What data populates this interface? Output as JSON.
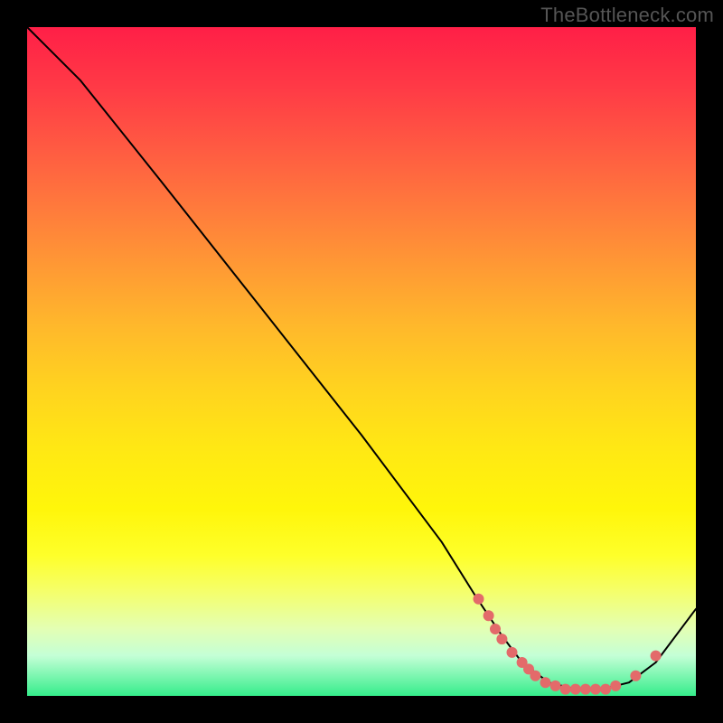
{
  "watermark": "TheBottleneck.com",
  "chart_data": {
    "type": "line",
    "title": "",
    "xlabel": "",
    "ylabel": "",
    "xlim": [
      0,
      100
    ],
    "ylim": [
      0,
      100
    ],
    "grid": false,
    "legend": false,
    "series": [
      {
        "name": "curve",
        "x": [
          0,
          3,
          8,
          20,
          35,
          50,
          62,
          67,
          71,
          74,
          78,
          82,
          86,
          90,
          94,
          100
        ],
        "y": [
          100,
          97,
          92,
          77,
          58,
          39,
          23,
          15,
          9,
          5,
          2,
          1,
          1,
          2,
          5,
          13
        ]
      }
    ],
    "markers": {
      "name": "dots",
      "color": "#e36a6a",
      "x": [
        67.5,
        69,
        70,
        71,
        72.5,
        74,
        75,
        76,
        77.5,
        79,
        80.5,
        82,
        83.5,
        85,
        86.5,
        88,
        91,
        94
      ],
      "y": [
        14.5,
        12,
        10,
        8.5,
        6.5,
        5,
        4,
        3,
        2,
        1.5,
        1,
        1,
        1,
        1,
        1,
        1.5,
        3,
        6
      ]
    }
  }
}
